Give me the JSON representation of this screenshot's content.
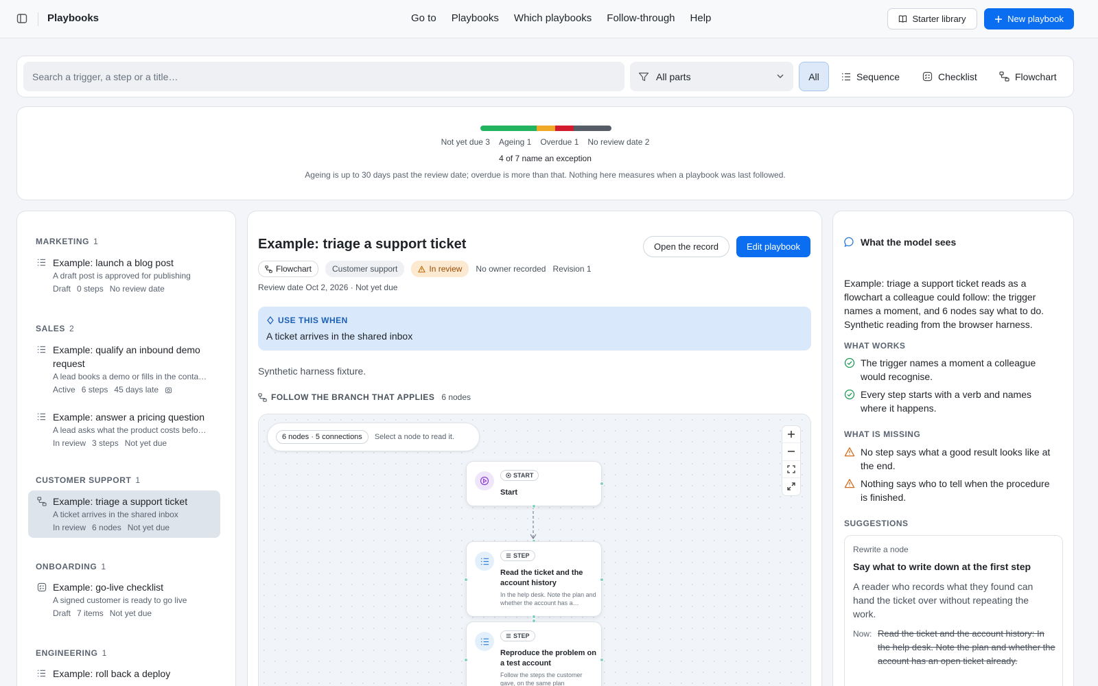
{
  "topbar": {
    "title": "Playbooks",
    "nav": [
      "Go to",
      "Playbooks",
      "Which playbooks",
      "Follow-through",
      "Help"
    ],
    "starter_label": "Starter library",
    "new_label": "New playbook"
  },
  "filters": {
    "search_placeholder": "Search a trigger, a step or a title…",
    "parts_value": "All parts",
    "seg_all": "All",
    "seg_sequence": "Sequence",
    "seg_checklist": "Checklist",
    "seg_flowchart": "Flowchart"
  },
  "summary": {
    "segments": [
      {
        "label": "Not yet due",
        "count": 3,
        "color": "#22b35e"
      },
      {
        "label": "Ageing",
        "count": 1,
        "color": "#f0a927"
      },
      {
        "label": "Overdue",
        "count": 1,
        "color": "#d31b2e"
      },
      {
        "label": "No review date",
        "count": 2,
        "color": "#565d67"
      }
    ],
    "legend": [
      "Not yet due 3",
      "Ageing 1",
      "Overdue 1",
      "No review date 2"
    ],
    "exceptions": "4 of 7 name an exception",
    "note": "Ageing is up to 30 days past the review date; overdue is more than that. Nothing here measures when a playbook was last followed."
  },
  "groups": [
    {
      "name": "MARKETING",
      "count": "1"
    },
    {
      "name": "SALES",
      "count": "2"
    },
    {
      "name": "CUSTOMER SUPPORT",
      "count": "1"
    },
    {
      "name": "ONBOARDING",
      "count": "1"
    },
    {
      "name": "ENGINEERING",
      "count": "1"
    }
  ],
  "items": [
    {
      "title": "Example: launch a blog post",
      "desc": "A draft post is approved for publishing",
      "meta": [
        "Draft",
        "0 steps",
        "No review date"
      ],
      "icon": "list-icon"
    },
    {
      "title": "Example: qualify an inbound demo request",
      "desc": "A lead books a demo or fills in the conta…",
      "meta": [
        "Active",
        "6 steps",
        "45 days late"
      ],
      "icon": "list-icon"
    },
    {
      "title": "Example: answer a pricing question",
      "desc": "A lead asks what the product costs befo…",
      "meta": [
        "In review",
        "3 steps",
        "Not yet due"
      ],
      "icon": "list-icon"
    },
    {
      "title": "Example: triage a support ticket",
      "desc": "A ticket arrives in the shared inbox",
      "meta": [
        "In review",
        "6 nodes",
        "Not yet due"
      ],
      "icon": "flowchart-icon"
    },
    {
      "title": "Example: go-live checklist",
      "desc": "A signed customer is ready to go live",
      "meta": [
        "Draft",
        "7 items",
        "Not yet due"
      ],
      "icon": "checklist-icon"
    },
    {
      "title": "Example: roll back a deploy",
      "desc": "",
      "meta": [],
      "icon": "list-icon"
    }
  ],
  "detail": {
    "title": "Example: triage a support ticket",
    "open_label": "Open the record",
    "edit_label": "Edit playbook",
    "chip_type": "Flowchart",
    "chip_team": "Customer support",
    "chip_status": "In review",
    "owner": "No owner recorded",
    "revision": "Revision 1",
    "review": "Review date Oct 2, 2026 · Not yet due",
    "use_when_label": "USE THIS WHEN",
    "use_when": "A ticket arrives in the shared inbox",
    "fixture": "Synthetic harness fixture.",
    "branch_label": "FOLLOW THE BRANCH THAT APPLIES",
    "branch_count": "6 nodes",
    "canvas_pill": "6 nodes · 5 connections",
    "canvas_hint": "Select a node to read it.",
    "nodes": [
      {
        "tag": "START",
        "title": "Start",
        "desc": ""
      },
      {
        "tag": "STEP",
        "title": "Read the ticket and the account history",
        "desc": "In the help desk. Note the plan and whether the account has a…"
      },
      {
        "tag": "STEP",
        "title": "Reproduce the problem on a test account",
        "desc": "Follow the steps the customer gave, on the same plan"
      }
    ]
  },
  "model": {
    "heading": "What the model sees",
    "intro": "Example: triage a support ticket reads as a flowchart a colleague could follow: the trigger names a moment, and 6 nodes say what to do. Synthetic reading from the browser harness.",
    "works_label": "WHAT WORKS",
    "works": [
      "The trigger names a moment a colleague would recognise.",
      "Every step starts with a verb and names where it happens."
    ],
    "missing_label": "WHAT IS MISSING",
    "missing": [
      "No step says what a good result looks like at the end.",
      "Nothing says who to tell when the procedure is finished."
    ],
    "suggestions_label": "SUGGESTIONS",
    "suggestion": {
      "kind": "Rewrite a node",
      "title": "Say what to write down at the first step",
      "body": "A reader who records what they found can hand the ticket over without repeating the work.",
      "now_label": "Now:",
      "now": "Read the ticket and the account history: In the help desk. Note the plan and whether the account has an open ticket already."
    }
  }
}
